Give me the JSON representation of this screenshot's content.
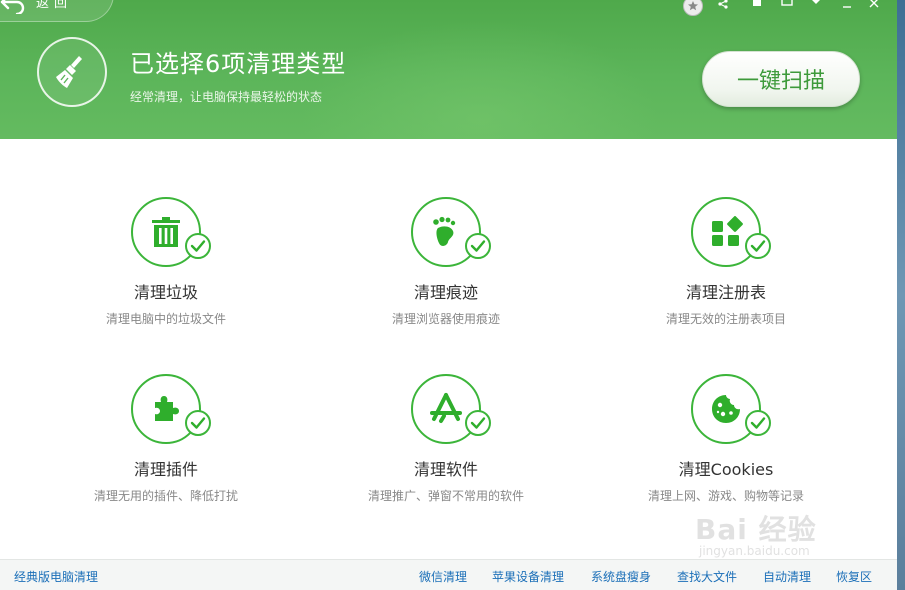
{
  "header": {
    "back_label": "返回",
    "title": "已选择6项清理类型",
    "subtitle": "经常清理，让电脑保持最轻松的状态",
    "scan_button": "一键扫描"
  },
  "colors": {
    "header_green": "#5cb55a",
    "accent_green": "#3cb53a",
    "link_blue": "#1b6fb8"
  },
  "items": [
    {
      "name": "清理垃圾",
      "desc": "清理电脑中的垃圾文件",
      "icon": "trash-icon",
      "checked": true
    },
    {
      "name": "清理痕迹",
      "desc": "清理浏览器使用痕迹",
      "icon": "footprint-icon",
      "checked": true
    },
    {
      "name": "清理注册表",
      "desc": "清理无效的注册表项目",
      "icon": "registry-icon",
      "checked": true
    },
    {
      "name": "清理插件",
      "desc": "清理无用的插件、降低打扰",
      "icon": "puzzle-icon",
      "checked": true
    },
    {
      "name": "清理软件",
      "desc": "清理推广、弹窗不常用的软件",
      "icon": "app-store-icon",
      "checked": true
    },
    {
      "name": "清理Cookies",
      "desc": "清理上网、游戏、购物等记录",
      "icon": "cookie-icon",
      "checked": true
    }
  ],
  "footer": {
    "classic": "经典版电脑清理",
    "links": [
      "微信清理",
      "苹果设备清理",
      "系统盘瘦身",
      "查找大文件",
      "自动清理",
      "恢复区"
    ]
  },
  "watermark": {
    "main": "Bai 经验",
    "sub": "jingyan.baidu.com"
  }
}
